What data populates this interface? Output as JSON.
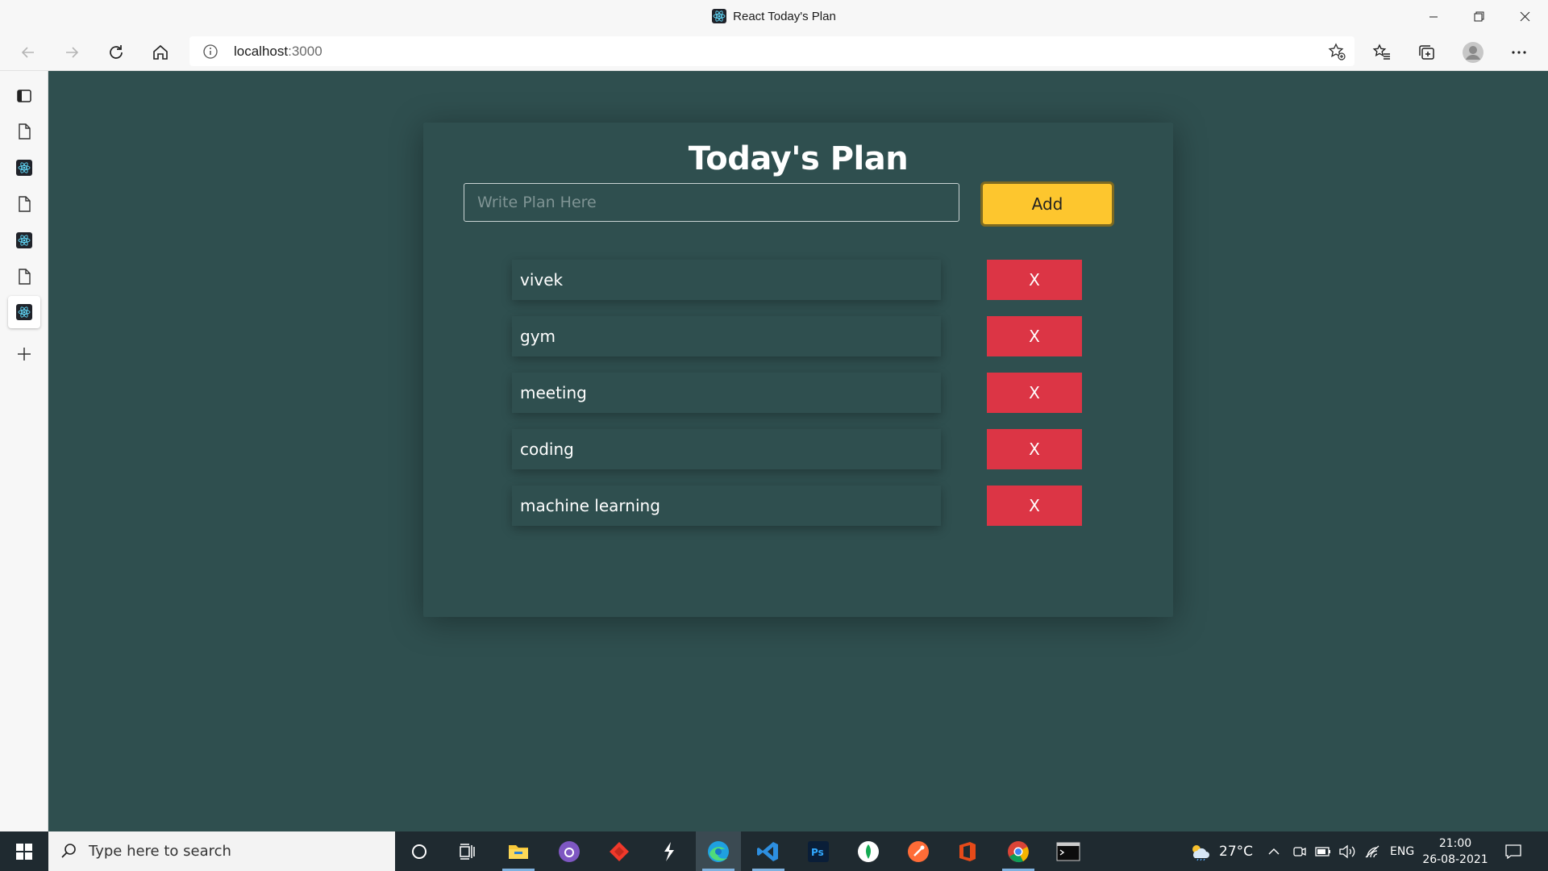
{
  "window": {
    "title": "React Today's Plan",
    "controls": [
      "minimize",
      "restore",
      "close"
    ]
  },
  "browser": {
    "url_host": "localhost",
    "url_port": ":3000"
  },
  "sidebar": {
    "tabs": [
      {
        "icon": "tab-actions-icon"
      },
      {
        "icon": "page-icon"
      },
      {
        "icon": "react-icon"
      },
      {
        "icon": "page-icon"
      },
      {
        "icon": "react-icon"
      },
      {
        "icon": "page-icon"
      },
      {
        "icon": "react-icon",
        "active": true
      }
    ],
    "new_tab": "plus-icon"
  },
  "app": {
    "heading": "Today's Plan",
    "input_placeholder": "Write Plan Here",
    "input_value": "",
    "add_label": "Add",
    "delete_label": "X",
    "plans": [
      "vivek",
      "gym",
      "meeting",
      "coding",
      "machine learning"
    ],
    "colors": {
      "background": "#2f4f4f",
      "add_button": "#fdc62e",
      "delete_button": "#dc3545"
    }
  },
  "taskbar": {
    "search_placeholder": "Type here to search",
    "weather": "27°C",
    "language": "ENG",
    "time": "21:00",
    "date": "26-08-2021"
  }
}
